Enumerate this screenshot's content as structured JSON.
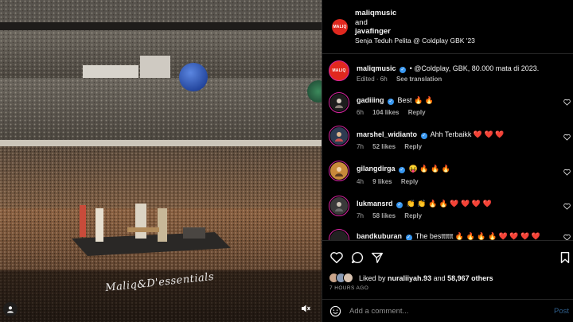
{
  "media": {
    "watermark": "Maliq&D'essentials"
  },
  "header": {
    "line1": "maliqmusic",
    "line2": "and",
    "line3": "javafinger",
    "location": "Senja Teduh Pelita @ Coldplay GBK '23",
    "avatar_text": "MALIQ"
  },
  "caption": {
    "user": "maliqmusic",
    "text": "• @Coldplay, GBK, 80.000 mata di 2023.",
    "edited": "Edited · 6h",
    "translate": "See translation"
  },
  "comments": [
    {
      "user": "gadiiing",
      "text": "Best 🔥 🔥",
      "time": "6h",
      "likes": "104 likes",
      "reply": "Reply"
    },
    {
      "user": "marshel_widianto",
      "text": "Ahh Terbaikk ❤️ ❤️ ❤️",
      "time": "7h",
      "likes": "52 likes",
      "reply": "Reply"
    },
    {
      "user": "gilangdirga",
      "text": "😝 🔥 🔥 🔥",
      "time": "4h",
      "likes": "9 likes",
      "reply": "Reply"
    },
    {
      "user": "lukmansrd",
      "text": "👏 👏 🔥 🔥 ❤️ ❤️ ❤️ ❤️",
      "time": "7h",
      "likes": "58 likes",
      "reply": "Reply"
    },
    {
      "user": "bandkuburan",
      "text": "The bestttttt 🔥 🔥 🔥 🔥 ❤️ ❤️ ❤️ ❤️",
      "time": "",
      "likes": "",
      "reply": ""
    }
  ],
  "liked_by": {
    "prefix": "Liked by",
    "user": "nuraliiyah.93",
    "middle": "and",
    "others": "58,967 others"
  },
  "time_ago": "7 HOURS AGO",
  "add_comment": {
    "placeholder": "Add a comment...",
    "post_label": "Post"
  },
  "colors": {
    "brand_red": "#e0281f",
    "verified_blue": "#3897f0",
    "post_blue": "#2f5e8a",
    "balloon_blue": "#2f5bb8"
  }
}
